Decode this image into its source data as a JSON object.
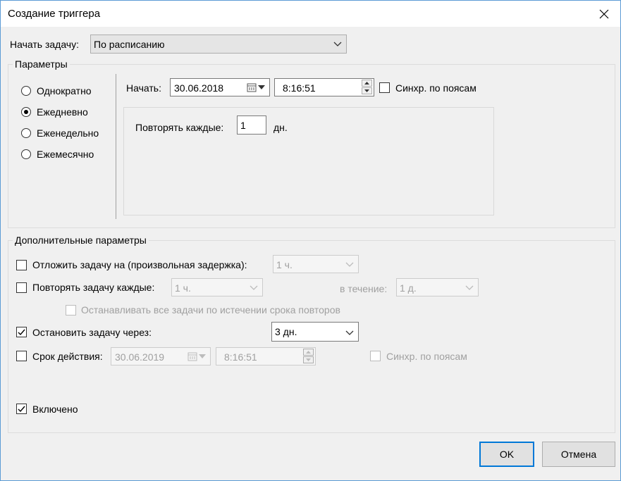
{
  "window": {
    "title": "Создание триггера"
  },
  "icons": {
    "close": "close-icon",
    "dropdown": "chevron-down-icon",
    "calendar": "calendar-icon",
    "spin_up": "spin-up-icon",
    "spin_down": "spin-down-icon",
    "check": "checkmark-icon"
  },
  "start_task": {
    "label": "Начать задачу:",
    "value": "По расписанию"
  },
  "params": {
    "legend": "Параметры",
    "radios": [
      {
        "label": "Однократно",
        "selected": false
      },
      {
        "label": "Ежедневно",
        "selected": true
      },
      {
        "label": "Еженедельно",
        "selected": false
      },
      {
        "label": "Ежемесячно",
        "selected": false
      }
    ],
    "start_label": "Начать:",
    "start_date": "30.06.2018",
    "start_time": "8:16:51",
    "sync_label": "Синхр. по поясам",
    "repeat_label": "Повторять каждые:",
    "repeat_value": "1",
    "repeat_unit": "дн."
  },
  "advanced": {
    "legend": "Дополнительные параметры",
    "delay_label": "Отложить задачу на (произвольная задержка):",
    "delay_value": "1 ч.",
    "repeat_label": "Повторять задачу каждые:",
    "repeat_value": "1 ч.",
    "duration_label": "в течение:",
    "duration_value": "1 д.",
    "stop_all_label": "Останавливать все задачи по истечении срока повторов",
    "stop_after_label": "Остановить задачу через:",
    "stop_after_value": "3 дн.",
    "expire_label": "Срок действия:",
    "expire_date": "30.06.2019",
    "expire_time": "8:16:51",
    "expire_sync_label": "Синхр. по поясам",
    "enabled_label": "Включено"
  },
  "buttons": {
    "ok": "OK",
    "cancel": "Отмена"
  }
}
